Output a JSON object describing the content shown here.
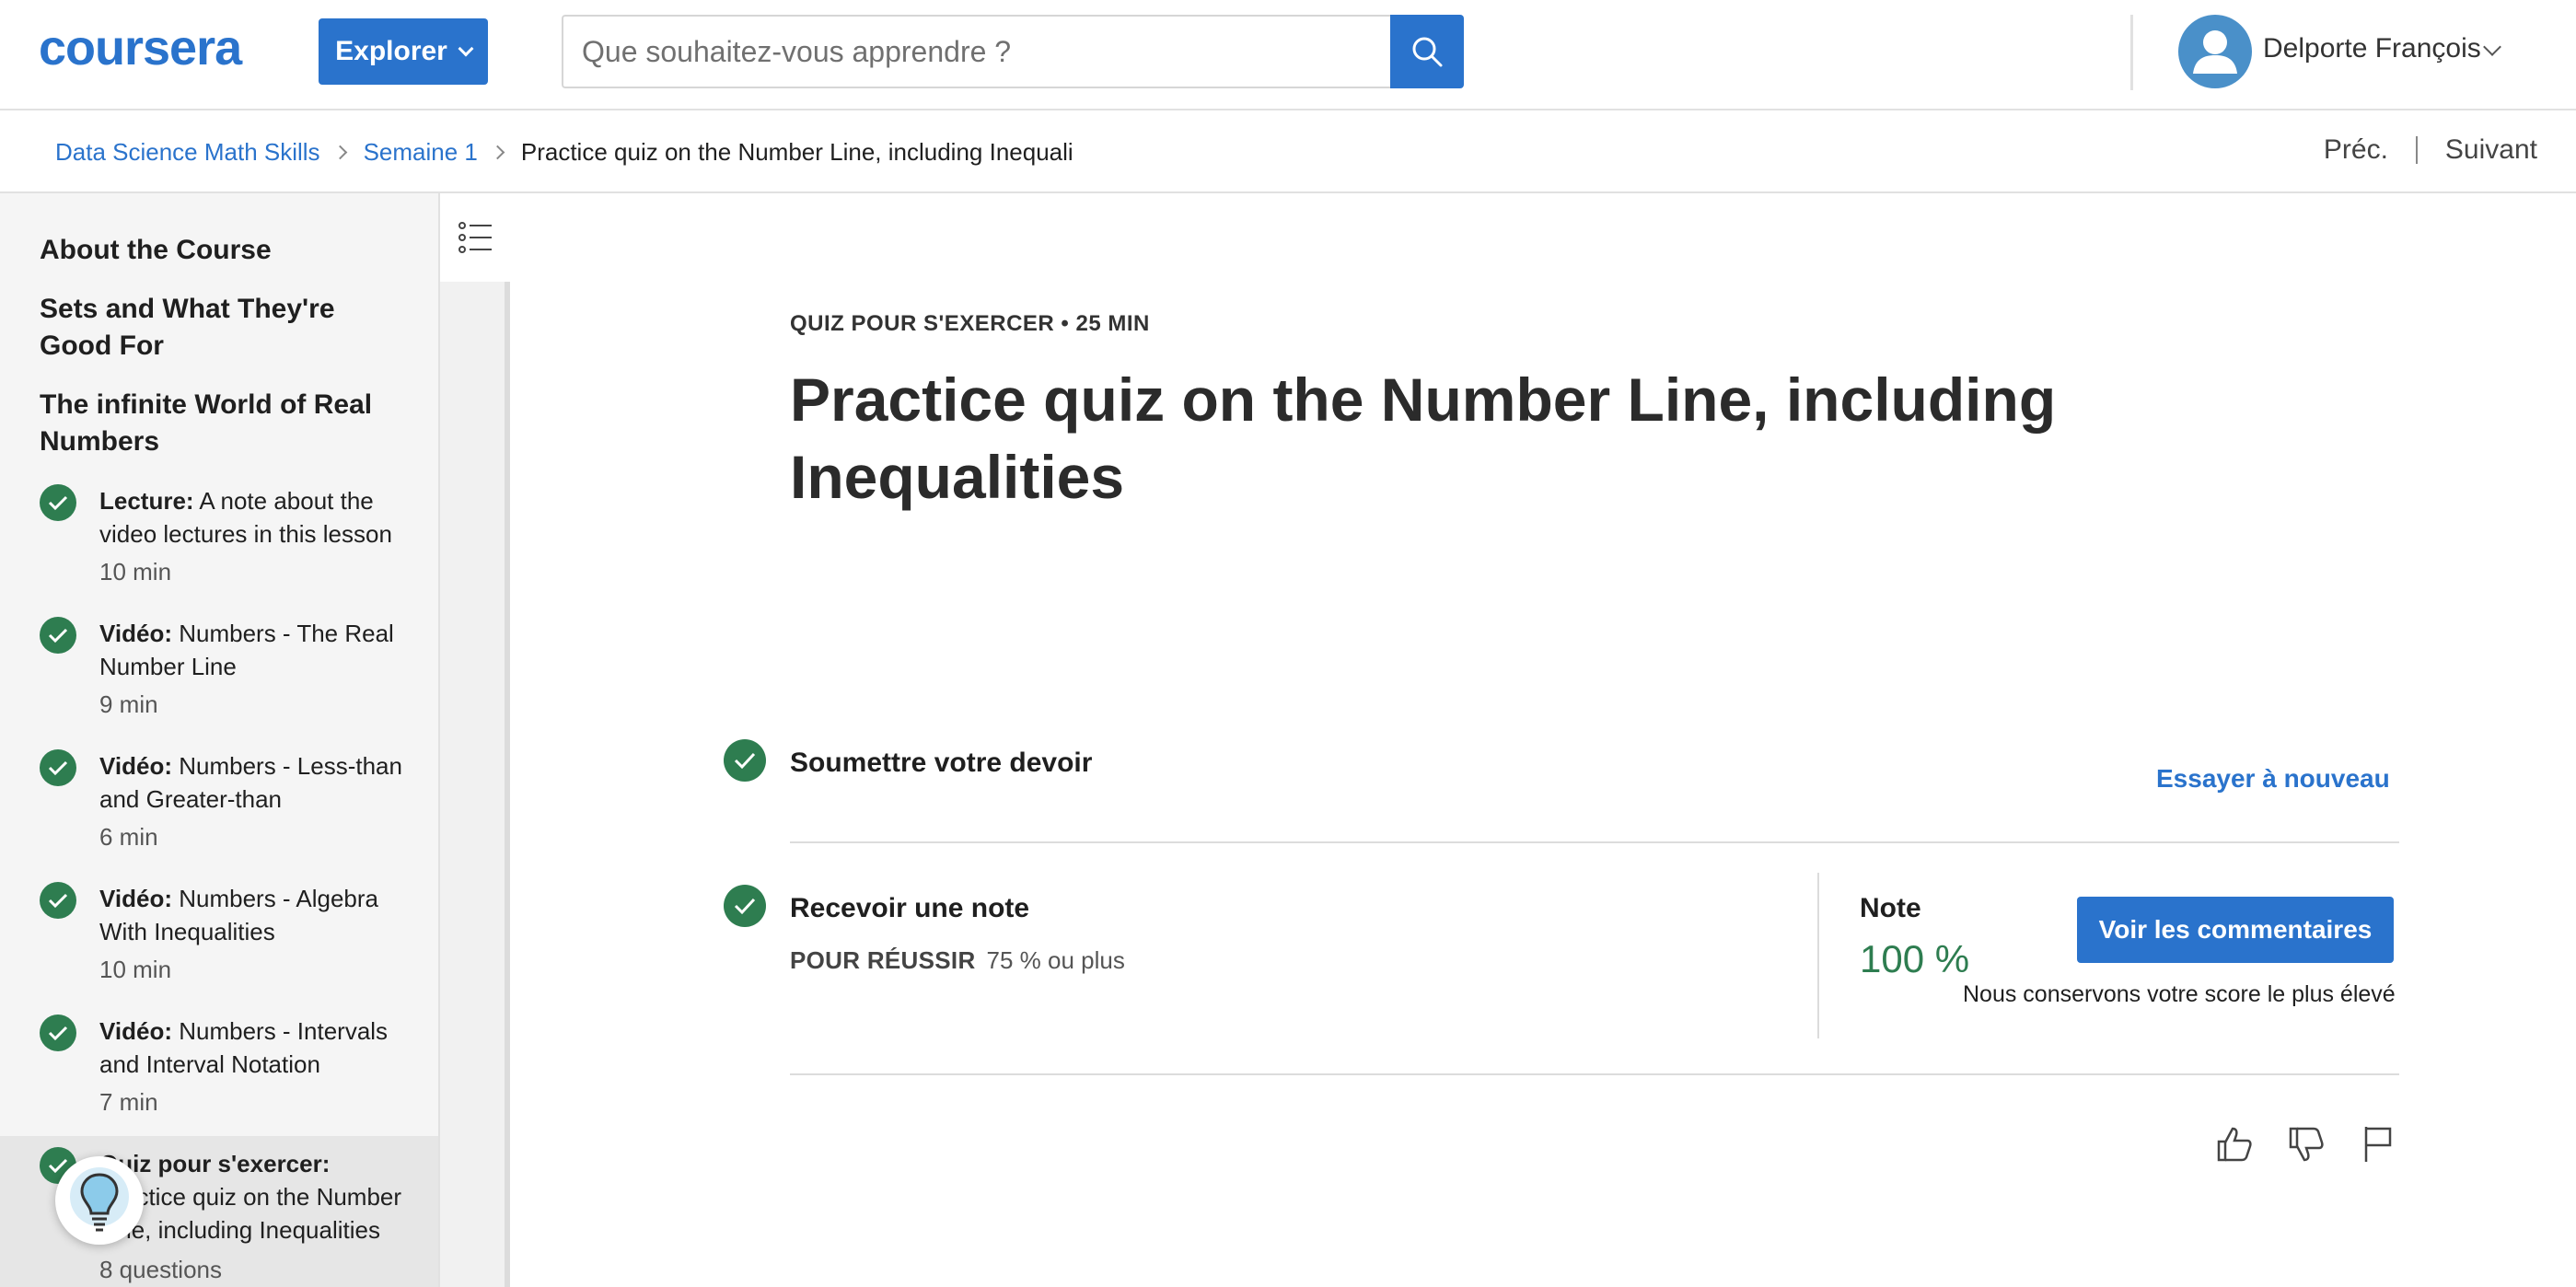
{
  "header": {
    "logo_text": "coursera",
    "explore_label": "Explorer",
    "search_placeholder": "Que souhaitez-vous apprendre ?",
    "user_name": "Delporte François"
  },
  "breadcrumb": {
    "course": "Data Science Math Skills",
    "week": "Semaine 1",
    "current": "Practice quiz on the Number Line, including Inequalities",
    "prev_label": "Préc.",
    "next_label": "Suivant"
  },
  "sidebar": {
    "sections": [
      "About the Course",
      "Sets and What They're Good For",
      "The infinite World of Real Numbers"
    ],
    "items": [
      {
        "type": "Lecture:",
        "title": "A note about the video lectures in this lesson",
        "duration": "10  min"
      },
      {
        "type": "Vidéo:",
        "title": "Numbers - The Real Number Line",
        "duration": "9  min"
      },
      {
        "type": "Vidéo:",
        "title": "Numbers - Less-than and Greater-than",
        "duration": "6  min"
      },
      {
        "type": "Vidéo:",
        "title": "Numbers - Algebra With Inequalities",
        "duration": "10  min"
      },
      {
        "type": "Vidéo:",
        "title": "Numbers - Intervals and Interval Notation",
        "duration": "7  min"
      },
      {
        "type": "Quiz pour s'exercer:",
        "title": "Practice quiz on the Number Line, including Inequalities",
        "duration": "8 questions"
      }
    ]
  },
  "main": {
    "kicker": "QUIZ POUR S'EXERCER • 25  MIN",
    "title": "Practice quiz on the Number Line, including Inequalities",
    "submit_label": "Soumettre votre devoir",
    "retry_label": "Essayer à nouveau",
    "grade_label": "Recevoir une note",
    "pass_label": "POUR RÉUSSIR",
    "pass_value": "75 % ou plus",
    "note_label": "Note",
    "note_value": "100 %",
    "feedback_label": "Voir les commentaires",
    "keep_note": "Nous conservons votre score le plus élevé"
  },
  "colors": {
    "brand_blue": "#2a73cc",
    "success_green": "#2e7d50"
  },
  "icons": [
    "search-icon",
    "user-avatar-icon",
    "list-icon",
    "check-icon",
    "lightbulb-icon",
    "thumbs-up-icon",
    "thumbs-down-icon",
    "flag-icon"
  ]
}
